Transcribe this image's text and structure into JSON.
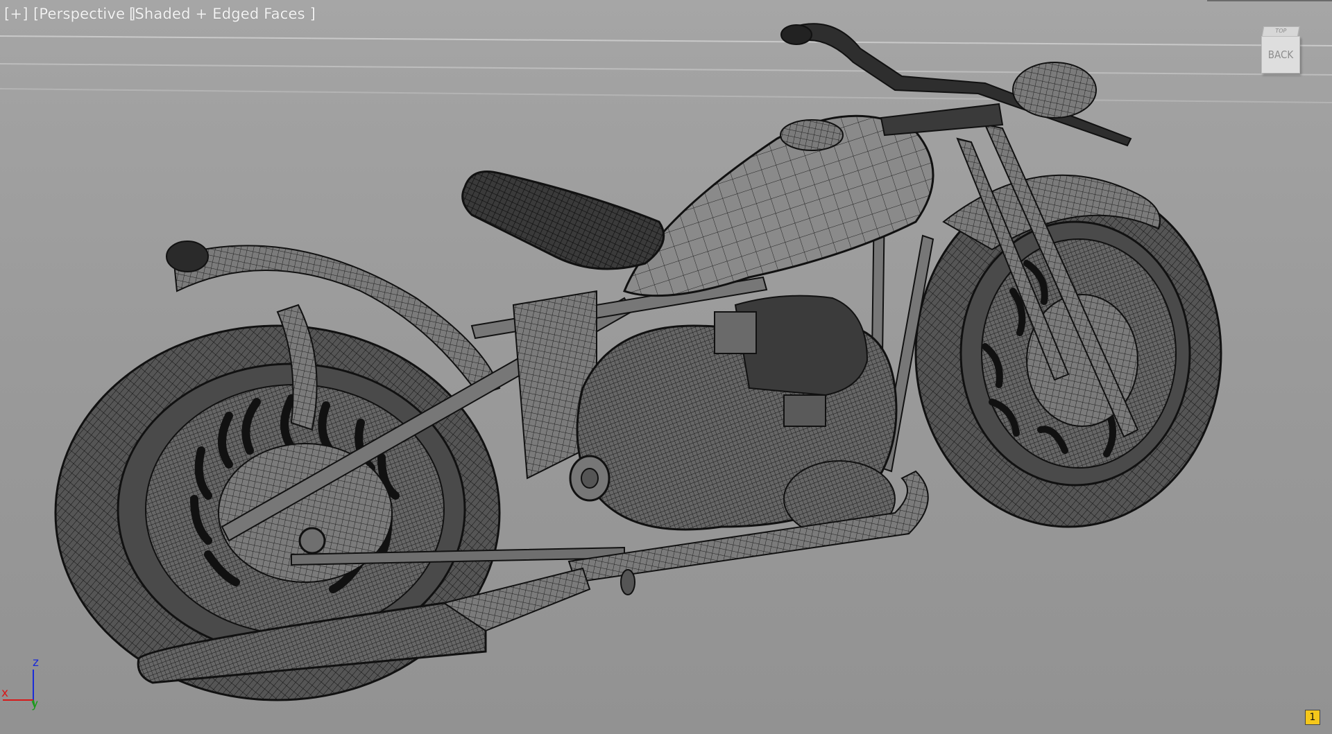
{
  "viewport": {
    "menu_plus": "[+]",
    "view_mode": "[Perspective ]",
    "shading_mode": "[Shaded + Edged Faces ]",
    "viewport_number": "1"
  },
  "viewcube": {
    "face_label": "BACK",
    "top_label": "TOP"
  },
  "axis_tripod": {
    "x": "x",
    "y": "y",
    "z": "z"
  },
  "colors": {
    "background": "#9a9a9a",
    "wire": "#1c1c1c",
    "axis_x": "#d81818",
    "axis_y": "#1b9a1b",
    "axis_z": "#1a2bd8",
    "viewport_badge": "#f5c71a"
  }
}
